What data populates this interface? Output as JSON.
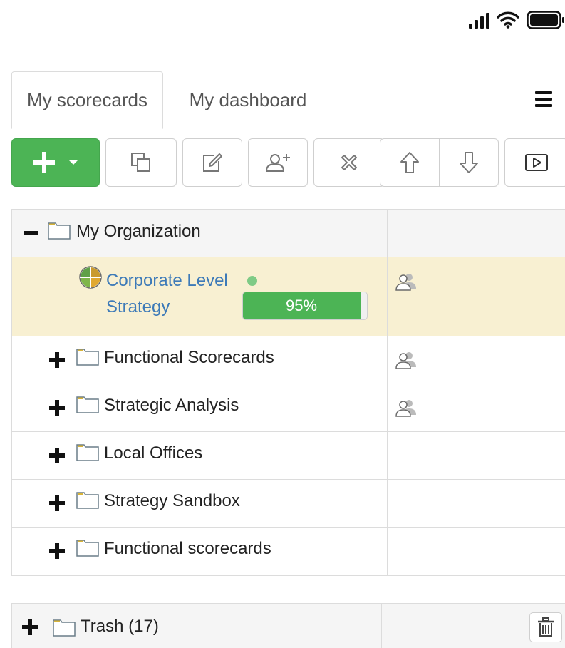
{
  "status_bar": {
    "signal_icon": "cellular-signal-icon",
    "wifi_icon": "wifi-icon",
    "battery_icon": "battery-icon"
  },
  "tabs": [
    {
      "label": "My scorecards",
      "active": true
    },
    {
      "label": "My dashboard",
      "active": false
    }
  ],
  "menu_icon": "hamburger-menu-icon",
  "toolbar": {
    "add_icon": "plus-icon",
    "buttons": [
      "copy-icon",
      "edit-icon",
      "add-user-icon",
      "delete-icon",
      "arrow-up-icon",
      "arrow-down-icon",
      "play-icon"
    ],
    "accent": "#4cb455"
  },
  "tree": {
    "root": {
      "label": "My Organization",
      "expanded": true
    },
    "scorecard": {
      "title": "Corporate Level Strategy",
      "progress": 0.95,
      "progress_label": "95%",
      "status_color": "#7fcb86"
    },
    "folders": [
      {
        "label": "Functional Scorecards",
        "shared": true
      },
      {
        "label": "Strategic Analysis",
        "shared": true
      },
      {
        "label": "Local Offices",
        "shared": false
      },
      {
        "label": "Strategy Sandbox",
        "shared": false
      },
      {
        "label": "Functional scorecards",
        "shared": false
      }
    ]
  },
  "trash": {
    "label": "Trash (17)",
    "icon": "trash-icon"
  }
}
